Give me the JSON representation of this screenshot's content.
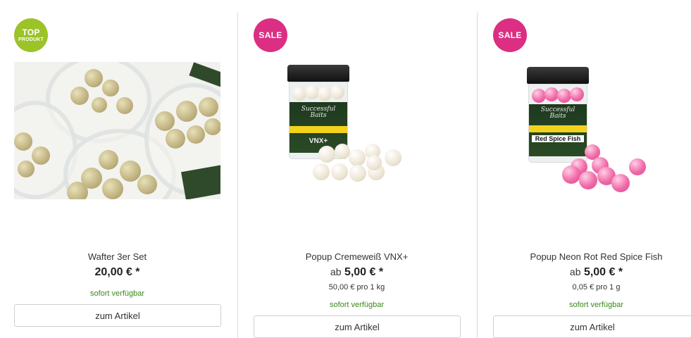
{
  "products": [
    {
      "badge": {
        "line1": "TOP",
        "line2": "PRODUKT",
        "color": "#9cc328"
      },
      "title": "Wafter 3er Set",
      "price_prefix": "",
      "price": "20,00 € *",
      "unit_price": "",
      "availability": "sofort verfügbar",
      "button": "zum Artikel"
    },
    {
      "badge": {
        "line1": "SALE",
        "color": "#dc2e83"
      },
      "title": "Popup Cremeweiß VNX+",
      "price_prefix": "ab",
      "price": "5,00 € *",
      "unit_price": "50,00 € pro 1 kg",
      "availability": "sofort verfügbar",
      "button": "zum Artikel"
    },
    {
      "badge": {
        "line1": "SALE",
        "color": "#dc2e83"
      },
      "title": "Popup Neon Rot Red Spice Fish",
      "price_prefix": "ab",
      "price": "5,00 € *",
      "unit_price": "0,05 € pro 1 g",
      "availability": "sofort verfügbar",
      "button": "zum Artikel"
    }
  ],
  "colors": {
    "availability": "#3a8a1a",
    "divider": "#dadada"
  }
}
